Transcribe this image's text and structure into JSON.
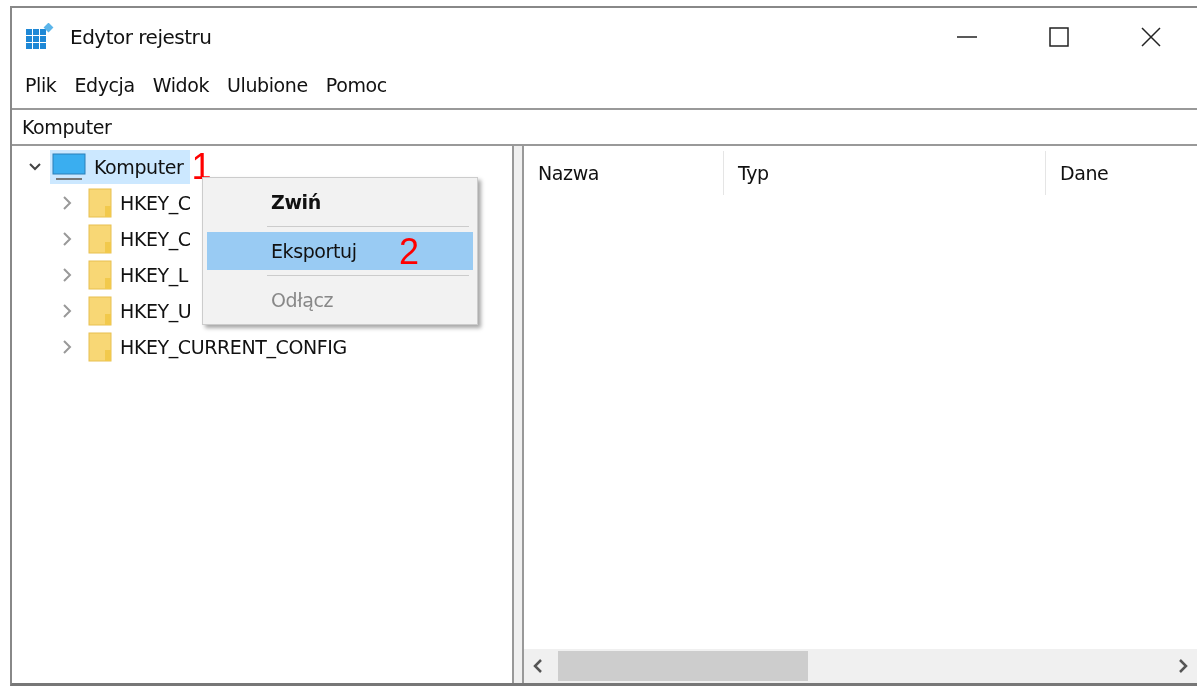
{
  "window": {
    "title": "Edytor rejestru"
  },
  "menu_bar": [
    {
      "label": "Plik"
    },
    {
      "label": "Edycja"
    },
    {
      "label": "Widok"
    },
    {
      "label": "Ulubione"
    },
    {
      "label": "Pomoc"
    }
  ],
  "address_bar": {
    "value": "Komputer"
  },
  "tree": {
    "label": "Komputer",
    "expanded": true,
    "selected": true,
    "annotation": "1",
    "children": [
      {
        "label": "HKEY_C",
        "expanded": false,
        "selected": false
      },
      {
        "label": "HKEY_C",
        "expanded": false,
        "selected": false
      },
      {
        "label": "HKEY_L",
        "expanded": false,
        "selected": false
      },
      {
        "label": "HKEY_U",
        "expanded": false,
        "selected": false
      },
      {
        "label": "HKEY_CURRENT_CONFIG",
        "expanded": false,
        "selected": false
      }
    ]
  },
  "context_menu": [
    {
      "label": "Zwiń",
      "default": true,
      "selected": false,
      "disabled": false
    },
    {
      "label": "Eksportuj",
      "default": false,
      "selected": true,
      "disabled": false,
      "annotation": "2"
    },
    {
      "label": "Odłącz",
      "default": false,
      "selected": false,
      "disabled": true
    }
  ],
  "list": {
    "columns": [
      "Nazwa",
      "Typ",
      "Dane"
    ]
  }
}
